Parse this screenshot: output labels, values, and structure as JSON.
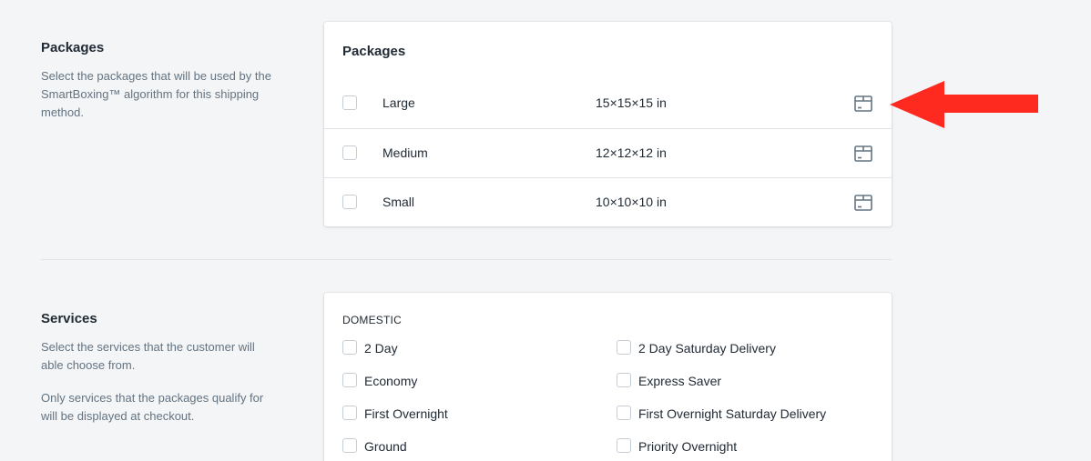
{
  "packages_section": {
    "title": "Packages",
    "description": "Select the packages that will be used by the SmartBoxing™ algorithm for this shipping method."
  },
  "packages_card": {
    "title": "Packages",
    "rows": [
      {
        "name": "Large",
        "dimensions": "15×15×15 in",
        "checked": false,
        "icon": "package-box-icon"
      },
      {
        "name": "Medium",
        "dimensions": "12×12×12 in",
        "checked": false,
        "icon": "package-box-icon"
      },
      {
        "name": "Small",
        "dimensions": "10×10×10 in",
        "checked": false,
        "icon": "package-box-icon"
      }
    ]
  },
  "services_section": {
    "title": "Services",
    "description_1": "Select the services that the customer will able choose from.",
    "description_2": "Only services that the packages qualify for will be displayed at checkout."
  },
  "services_card": {
    "group_label": "DOMESTIC",
    "services": [
      {
        "label": "2 Day",
        "checked": false
      },
      {
        "label": "2 Day Saturday Delivery",
        "checked": false
      },
      {
        "label": "Economy",
        "checked": false
      },
      {
        "label": "Express Saver",
        "checked": false
      },
      {
        "label": "First Overnight",
        "checked": false
      },
      {
        "label": "First Overnight Saturday Delivery",
        "checked": false
      },
      {
        "label": "Ground",
        "checked": false
      },
      {
        "label": "Priority Overnight",
        "checked": false
      }
    ]
  },
  "colors": {
    "background": "#f4f5f7",
    "card": "#ffffff",
    "text": "#212b36",
    "muted_text": "#637381",
    "divider": "#dfe3e8",
    "arrow": "#ff2a1f"
  }
}
